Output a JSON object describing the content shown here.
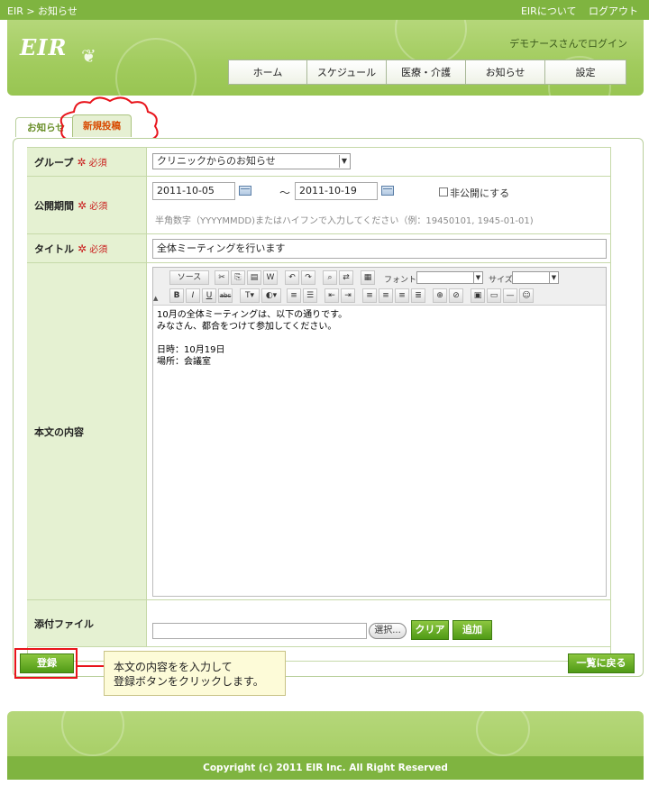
{
  "topbar": {
    "breadcrumb": "EIR > お知らせ",
    "about_link": "EIRについて",
    "logout_link": "ログアウト"
  },
  "header": {
    "logo": "EIR",
    "user_message": "デモナースさんでログイン",
    "nav": [
      "ホーム",
      "スケジュール",
      "医療・介護",
      "お知らせ",
      "設定"
    ]
  },
  "tabs": {
    "info": "お知らせ",
    "new_post": "新規投稿"
  },
  "form": {
    "required_label": "必須",
    "group": {
      "label": "グループ",
      "selected": "クリニックからのお知らせ"
    },
    "period": {
      "label": "公開期間",
      "start": "2011-10-05",
      "separator": "〜",
      "end": "2011-10-19",
      "private_label": "非公開にする",
      "hint": "半角数字（YYYYMMDD)またはハイフンで入力してください（例：19450101, 1945-01-01)"
    },
    "title": {
      "label": "タイトル",
      "value": "全体ミーティングを行います"
    },
    "body": {
      "label": "本文の内容",
      "toolbar": {
        "source_label": "ソース",
        "font_label": "フォント",
        "size_label": "サイズ"
      },
      "lines": [
        "10月の全体ミーティングは、以下の通りです。",
        "みなさん、都合をつけて参加してください。",
        "",
        "日時：10月19日",
        "場所：会議室"
      ]
    },
    "attachment": {
      "label": "添付ファイル",
      "browse_button": "選択...",
      "clear_button": "クリア",
      "add_button": "追加"
    }
  },
  "actions": {
    "register_button": "登録",
    "back_button": "一覧に戻る"
  },
  "callout": {
    "line1": "本文の内容をを入力して",
    "line2": "登録ボタンをクリックします。"
  },
  "footer": {
    "copyright": "Copyright (c) 2011 EIR Inc. All Right Reserved"
  },
  "colors": {
    "brand_green": "#7fb440",
    "label_bg": "#e5f1d2",
    "highlight_red": "#e8141b",
    "required_red": "#c91a1a"
  }
}
